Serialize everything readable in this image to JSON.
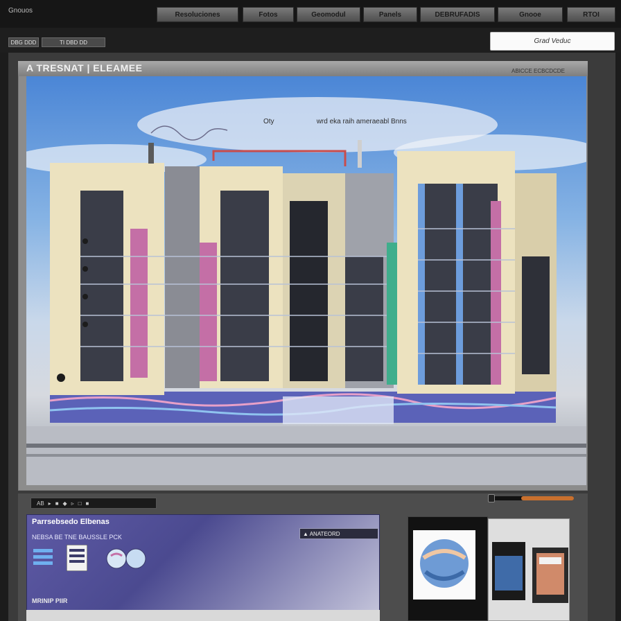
{
  "app": {
    "brand": "Gnouos"
  },
  "nav": {
    "items": [
      {
        "label": "Resoluciones"
      },
      {
        "label": "Fotos"
      },
      {
        "label": "Geomodul"
      },
      {
        "label": "Panels"
      },
      {
        "label": "DEBRUFADIS"
      },
      {
        "label": "Gnooe"
      },
      {
        "label": "RTOI"
      }
    ]
  },
  "subnav": {
    "btn_one": "DBG DDD",
    "btn_two": "TI DBD DD"
  },
  "search": {
    "placeholder": "Grad Veduc"
  },
  "panel": {
    "title": "A TRESNAT | ELEAMEE",
    "meta": "ABICCE ECBCDCDE"
  },
  "render": {
    "caption": "wrd eka raih ameraeabl Bnns",
    "annotation": "Oty"
  },
  "toolstrip": {
    "items": [
      "AB",
      "▸",
      "■",
      "◆",
      "▹",
      "□",
      "■"
    ]
  },
  "slider": {
    "value_fraction": 0.62
  },
  "card": {
    "title": "Parrsebsedo Elbenas",
    "subtitle": "NEBSA BE TNE BAUSSLE PCK",
    "pill": "▲ ANATEORD",
    "footer": "MRINIP PIIR"
  },
  "colors": {
    "accent": "#c9702e",
    "card_bg": "#4b4a90",
    "building_cream": "#ece2bf",
    "accent_pink": "#c46fa6",
    "accent_blue": "#6d9ddc",
    "accent_green": "#3fae8c"
  }
}
